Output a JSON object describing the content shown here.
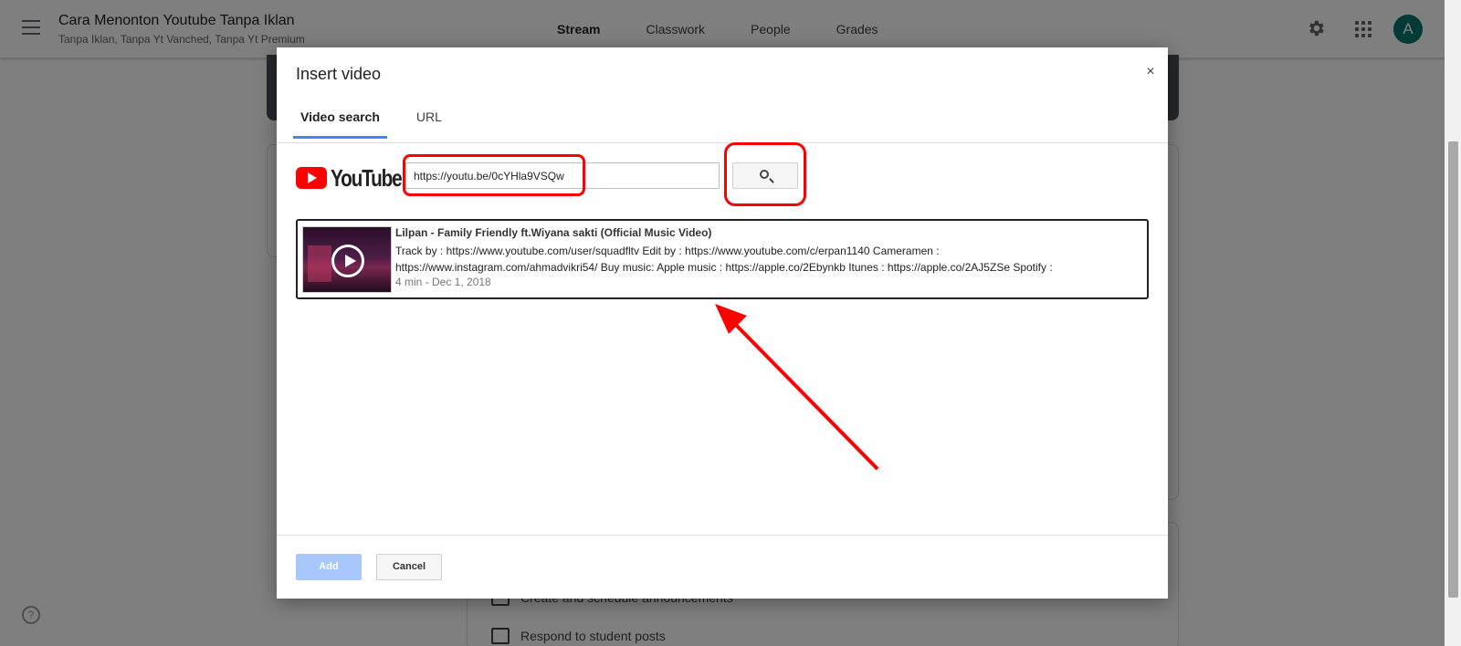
{
  "classroom": {
    "title": "Cara Menonton Youtube Tanpa Iklan",
    "subtitle": "Tanpa Iklan, Tanpa Yt Vanched, Tanpa Yt Premium",
    "nav": [
      "Stream",
      "Classwork",
      "People",
      "Grades"
    ],
    "avatar_letter": "A",
    "tips": [
      "Create and schedule announcements",
      "Respond to student posts"
    ],
    "help": "?"
  },
  "dialog": {
    "title": "Insert video",
    "close": "×",
    "tabs": [
      "Video search",
      "URL"
    ],
    "brand": "YouTube",
    "search_value": "https://youtu.be/0cYHla9VSQw",
    "result": {
      "title": "Lilpan - Family Friendly ft.Wiyana sakti (Official Music Video)",
      "description": "Track by : https://www.youtube.com/user/squadfltv Edit by : https://www.youtube.com/c/erpan1140 Cameramen : https://www.instagram.com/ahmadvikri54/ Buy music: Apple music : https://apple.co/2Ebynkb Itunes : https://apple.co/2AJ5ZSe Spotify :",
      "meta": "4 min - Dec 1, 2018"
    },
    "add_label": "Add",
    "cancel_label": "Cancel"
  },
  "colors": {
    "accent": "#4285f4",
    "annotation": "#ff0000",
    "avatar": "#00796b",
    "add_disabled": "#a8c7fa"
  }
}
